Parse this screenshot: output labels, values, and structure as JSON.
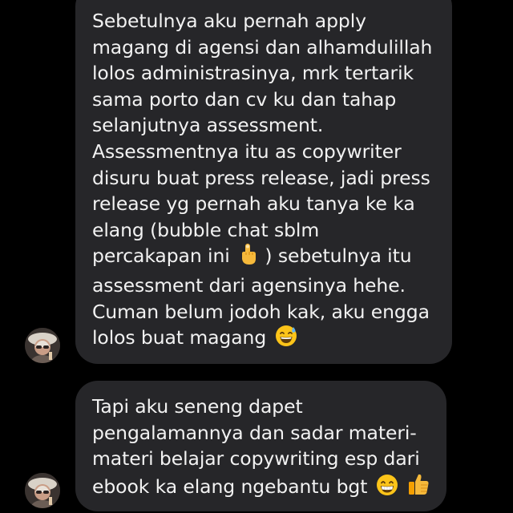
{
  "messages": [
    {
      "lines": [
        "Sebetulnya aku pernah apply",
        "magang di agensi dan alhamdulillah",
        "lolos administrasinya, mrk tertarik",
        "sama porto dan cv ku dan tahap",
        "selanjutnya assessment.",
        "Assessmentnya itu as copywriter",
        "disuru buat press release, jadi press",
        "release yg pernah aku tanya ke ka",
        "elang (bubble chat sblm"
      ],
      "line10_a": "percakapan ini",
      "line10_b": ") sebetulnya itu",
      "line11": "assessment dari agensinya hehe.",
      "line12": "Cuman belum jodoh kak, aku engga",
      "line13": "lolos buat magang",
      "emoji_pointing": "pointing-up-hand-emoji",
      "emoji_sweat": "grinning-sweat-emoji"
    },
    {
      "lines": [
        "Tapi aku seneng dapet",
        "pengalamannya dan sadar materi-",
        "materi belajar copywriting esp dari"
      ],
      "last_line": "ebook ka elang ngebantu bgt",
      "emoji_grin": "beaming-grin-emoji",
      "emoji_thumb": "thumbs-up-emoji"
    }
  ],
  "colors": {
    "background": "#000000",
    "bubble": "#262629",
    "text": "#f2f2f2"
  }
}
